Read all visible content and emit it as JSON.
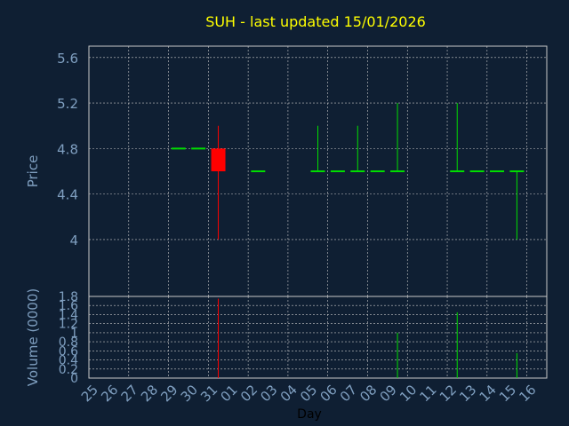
{
  "chart_data": [
    {
      "type": "candlestick",
      "title": "SUH - last updated 15/01/2026",
      "ylabel": "Price",
      "ylim": [
        3.5,
        5.7
      ],
      "yticks": [
        "4",
        "4.4",
        "4.8",
        "5.2",
        "5.6"
      ],
      "grid": true,
      "candles": [
        {
          "day": "29",
          "open": 4.8,
          "high": 4.8,
          "low": 4.8,
          "close": 4.8
        },
        {
          "day": "30",
          "open": 4.8,
          "high": 4.8,
          "low": 4.8,
          "close": 4.8
        },
        {
          "day": "31",
          "open": 4.8,
          "high": 5.0,
          "low": 4.0,
          "close": 4.6
        },
        {
          "day": "02",
          "open": 4.6,
          "high": 4.6,
          "low": 4.6,
          "close": 4.6
        },
        {
          "day": "05",
          "open": 4.6,
          "high": 5.0,
          "low": 4.6,
          "close": 4.6
        },
        {
          "day": "06",
          "open": 4.6,
          "high": 4.6,
          "low": 4.6,
          "close": 4.6
        },
        {
          "day": "07",
          "open": 4.6,
          "high": 5.0,
          "low": 4.6,
          "close": 4.6
        },
        {
          "day": "08",
          "open": 4.6,
          "high": 4.6,
          "low": 4.6,
          "close": 4.6
        },
        {
          "day": "09",
          "open": 4.6,
          "high": 5.2,
          "low": 4.6,
          "close": 4.6
        },
        {
          "day": "12",
          "open": 4.6,
          "high": 5.2,
          "low": 4.6,
          "close": 4.6
        },
        {
          "day": "13",
          "open": 4.6,
          "high": 4.6,
          "low": 4.6,
          "close": 4.6
        },
        {
          "day": "14",
          "open": 4.6,
          "high": 4.6,
          "low": 4.6,
          "close": 4.6
        },
        {
          "day": "15",
          "open": 4.6,
          "high": 4.6,
          "low": 4.0,
          "close": 4.6
        }
      ]
    },
    {
      "type": "bar",
      "ylabel": "Volume (0000)",
      "xlabel": "Day",
      "ylim": [
        0,
        1.8
      ],
      "yticks": [
        "0",
        "0.2",
        "0.4",
        "0.6",
        "0.8",
        "1",
        "1.2",
        "1.4",
        "1.6",
        "1.8"
      ],
      "grid": true,
      "bars": [
        {
          "day": "31",
          "value": 1.75,
          "color": "red"
        },
        {
          "day": "09",
          "value": 1.0,
          "color": "green"
        },
        {
          "day": "12",
          "value": 1.45,
          "color": "green"
        },
        {
          "day": "15",
          "value": 0.55,
          "color": "green"
        }
      ]
    }
  ],
  "x_ticks": [
    "25",
    "26",
    "27",
    "28",
    "29",
    "30",
    "31",
    "01",
    "02",
    "03",
    "04",
    "05",
    "06",
    "07",
    "08",
    "09",
    "10",
    "11",
    "12",
    "13",
    "14",
    "15",
    "16"
  ],
  "colors": {
    "background": "#0f1f33",
    "title": "#ffff00",
    "axis_text": "#7f9fc0",
    "frame": "#c8c8c8",
    "grid": "#c8c8c8",
    "up": "#00dd00",
    "down": "#ff0000"
  }
}
